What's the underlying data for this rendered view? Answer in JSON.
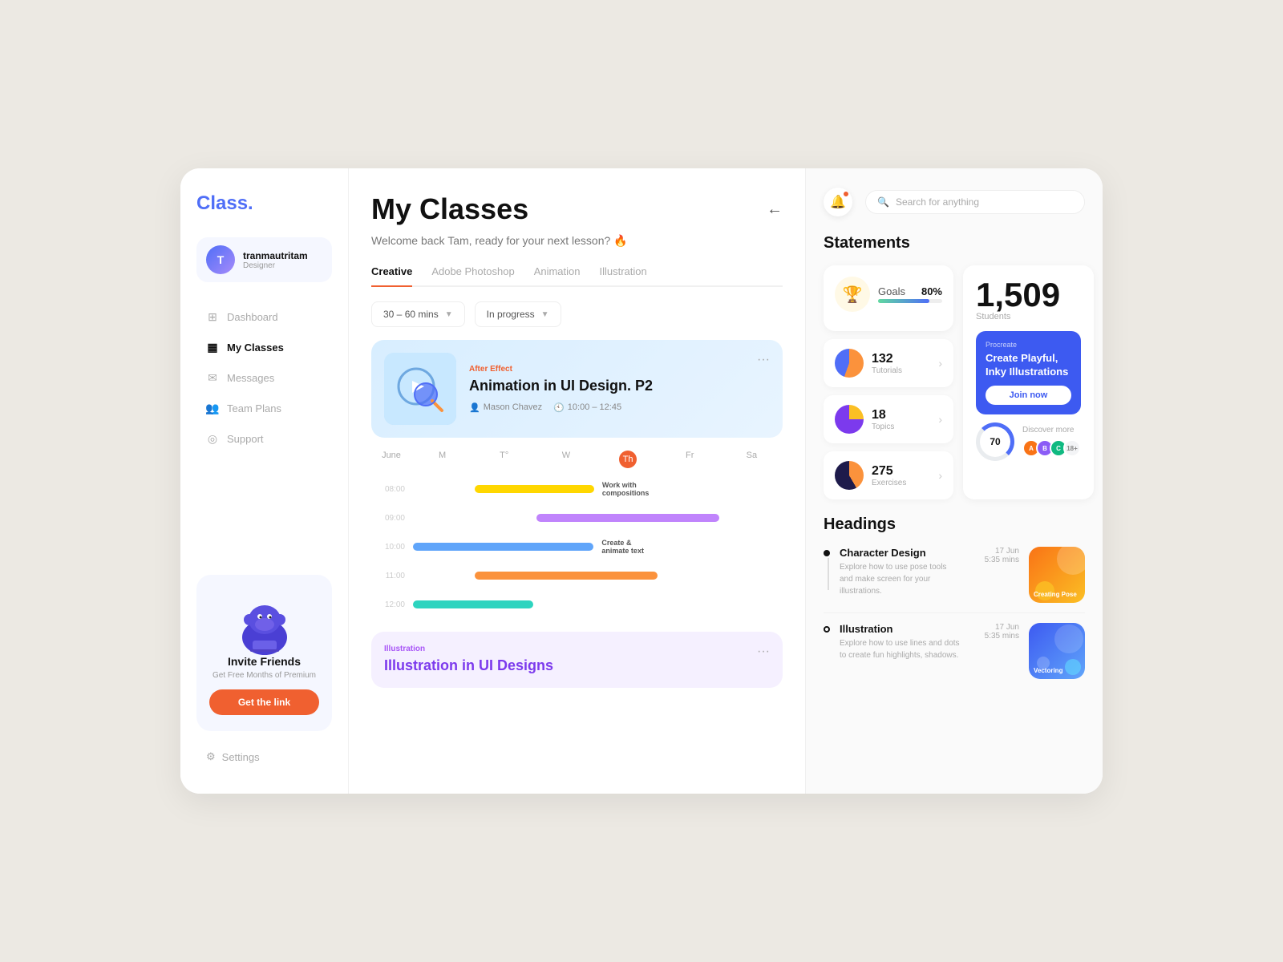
{
  "app": {
    "logo": "Class",
    "logo_dot": "."
  },
  "sidebar": {
    "user": {
      "name": "tranmautritam",
      "role": "Designer",
      "initials": "T"
    },
    "nav_items": [
      {
        "id": "dashboard",
        "label": "Dashboard",
        "active": false
      },
      {
        "id": "my-classes",
        "label": "My Classes",
        "active": true
      },
      {
        "id": "messages",
        "label": "Messages",
        "active": false
      },
      {
        "id": "team-plans",
        "label": "Team Plans",
        "active": false
      },
      {
        "id": "support",
        "label": "Support",
        "active": false
      }
    ],
    "invite": {
      "title": "Invite Friends",
      "subtitle": "Get Free Months of Premium",
      "cta": "Get the link"
    },
    "settings_label": "Settings"
  },
  "main": {
    "title": "My Classes",
    "welcome": "Welcome back Tam, ready for your next lesson? 🔥",
    "tabs": [
      "Creative",
      "Adobe Photoshop",
      "Animation",
      "Illustration"
    ],
    "active_tab": "Creative",
    "filters": {
      "duration": "30 – 60 mins",
      "status": "In progress"
    },
    "class_card_1": {
      "tag": "After Effect",
      "title": "Animation in UI Design. P2",
      "instructor": "Mason Chavez",
      "time": "10:00 – 12:45"
    },
    "calendar": {
      "month": "June",
      "days": [
        "M",
        "T°",
        "W",
        "Th",
        "Fr",
        "Sa"
      ],
      "today": "Th",
      "times": [
        "08:00",
        "09:00",
        "10:00",
        "11:00",
        "12:00"
      ],
      "events": [
        {
          "label": "Work with compositions",
          "row": 0,
          "col": 1,
          "span": 3,
          "color": "yellow"
        },
        {
          "label": "",
          "row": 1,
          "col": 2,
          "span": 3,
          "color": "purple"
        },
        {
          "label": "Create & animate text",
          "row": 2,
          "col": 1,
          "span": 4,
          "color": "blue"
        },
        {
          "label": "",
          "row": 3,
          "col": 2,
          "span": 3,
          "color": "orange"
        },
        {
          "label": "",
          "row": 4,
          "col": 1,
          "span": 2,
          "color": "teal"
        }
      ]
    },
    "class_card_2": {
      "tag": "Illustration",
      "title": "Illustration in UI Designs"
    }
  },
  "right": {
    "search_placeholder": "Search for anything",
    "statements": {
      "title": "Statements",
      "goals": {
        "label": "Goals",
        "percent": "80%"
      },
      "stats": [
        {
          "num": "132",
          "sub": "Tutorials"
        },
        {
          "num": "18",
          "sub": "Topics"
        },
        {
          "num": "275",
          "sub": "Exercises"
        }
      ],
      "students": {
        "num": "1,509",
        "label": "Students"
      },
      "promo": {
        "brand": "Procreate",
        "title": "Create Playful, Inky Illustrations",
        "cta": "Join now"
      },
      "donut": {
        "value": "70",
        "sub": "Discover more"
      }
    },
    "headings": {
      "title": "Headings",
      "items": [
        {
          "name": "Character Design",
          "desc": "Explore how to use pose tools and make screen for your illustrations.",
          "thumb_label": "Creating Pose",
          "date": "17 Jun",
          "duration": "5:35 mins",
          "type": "creating-pose"
        },
        {
          "name": "Illustration",
          "desc": "Explore how to use lines and dots to create fun highlights, shadows.",
          "thumb_label": "Vectoring",
          "date": "17 Jun",
          "duration": "5:35 mins",
          "type": "vectoring"
        }
      ]
    }
  }
}
